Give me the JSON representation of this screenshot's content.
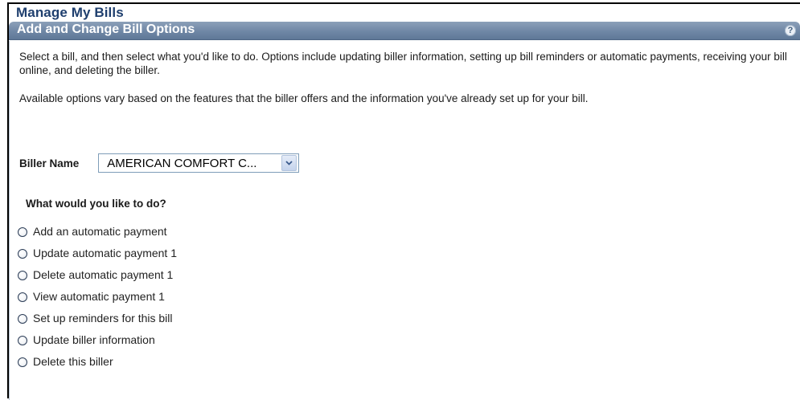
{
  "page": {
    "title": "Manage My Bills"
  },
  "section": {
    "title": "Add and Change Bill Options",
    "help_icon": "?"
  },
  "content": {
    "intro": "Select a bill, and then select what you'd like to do. Options include updating biller information, setting up bill reminders or automatic payments, receiving your bill online, and deleting the biller.",
    "availability": "Available options vary based on the features that the biller offers and the information you've already set up for your bill."
  },
  "biller": {
    "label": "Biller Name",
    "selected": "AMERICAN COMFORT C..."
  },
  "question": "What would you like to do?",
  "options": [
    {
      "label": "Add an automatic payment",
      "selected": false
    },
    {
      "label": "Update automatic payment 1",
      "selected": false
    },
    {
      "label": "Delete automatic payment 1",
      "selected": false
    },
    {
      "label": "View automatic payment 1",
      "selected": false
    },
    {
      "label": "Set up reminders for this bill",
      "selected": false
    },
    {
      "label": "Update biller information",
      "selected": false
    },
    {
      "label": "Delete this biller",
      "selected": false
    }
  ],
  "colors": {
    "header_bg": "#6f87a5",
    "title_text": "#1f3f6e",
    "border": "#000000"
  }
}
